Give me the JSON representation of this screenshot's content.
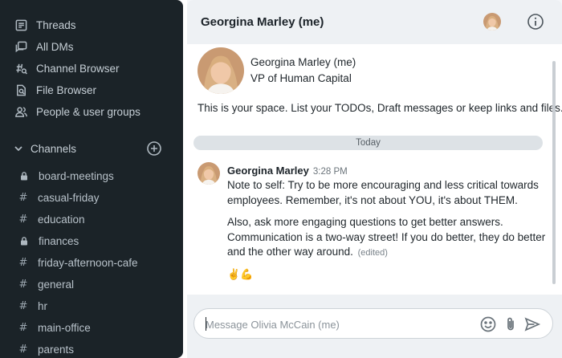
{
  "sidebar": {
    "nav": [
      {
        "label": "Threads",
        "icon": "threads-icon"
      },
      {
        "label": "All DMs",
        "icon": "dms-icon"
      },
      {
        "label": "Channel Browser",
        "icon": "channel-browser-icon"
      },
      {
        "label": "File Browser",
        "icon": "file-browser-icon"
      },
      {
        "label": "People & user groups",
        "icon": "people-icon"
      }
    ],
    "section_label": "Channels",
    "channels": [
      {
        "name": "board-meetings",
        "private": true
      },
      {
        "name": "casual-friday",
        "private": false
      },
      {
        "name": "education",
        "private": false
      },
      {
        "name": "finances",
        "private": true
      },
      {
        "name": "friday-afternoon-cafe",
        "private": false
      },
      {
        "name": "general",
        "private": false
      },
      {
        "name": "hr",
        "private": false
      },
      {
        "name": "main-office",
        "private": false
      },
      {
        "name": "parents",
        "private": false
      }
    ]
  },
  "header": {
    "title": "Georgina Marley (me)"
  },
  "profile": {
    "name": "Georgina Marley (me)",
    "role": "VP of Human Capital"
  },
  "intro": "This is your space. List your TODOs, Draft messages or keep links and files.",
  "divider": "Today",
  "message": {
    "author": "Georgina Marley",
    "time": "3:28 PM",
    "para1": "Note to self: Try to be more encouraging and less critical towards employees. Remember, it's not about YOU, it's about THEM.",
    "para2": "Also, ask more engaging questions to get better answers. Communication is a two-way street! If you do better, they do better and the other way around.",
    "edited": "(edited)",
    "reactions": "✌️💪"
  },
  "composer": {
    "placeholder": "Message Olivia McCain (me)",
    "value": ""
  },
  "colors": {
    "sidebar_bg": "#1b2328",
    "main_bg": "#f4f6f8",
    "divider_bg": "#dde2e6"
  }
}
